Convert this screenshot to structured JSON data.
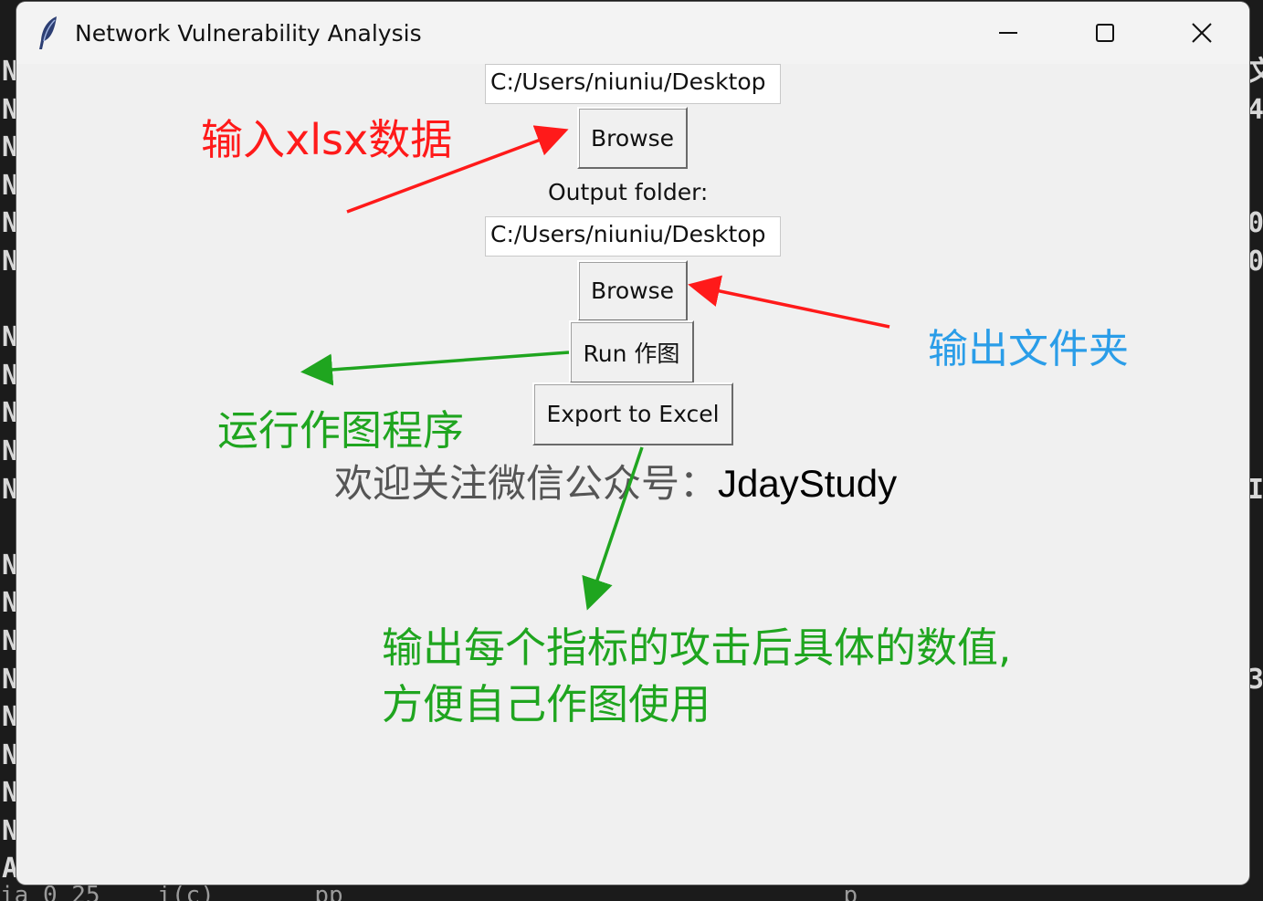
{
  "window": {
    "title": "Network Vulnerability Analysis"
  },
  "form": {
    "input_path": "C:/Users/niuniu/Desktop",
    "browse_input_label": "Browse",
    "output_label": "Output folder:",
    "output_path": "C:/Users/niuniu/Desktop",
    "browse_output_label": "Browse",
    "run_label": "Run 作图",
    "export_label": "Export to Excel"
  },
  "follow": {
    "prefix": "欢迎关注微信公众号：",
    "account": "JdayStudy"
  },
  "annotations": {
    "input_note": "输入xlsx数据",
    "output_note": "输出文件夹",
    "run_note": "运行作图程序",
    "export_note_line1": "输出每个指标的攻击后具体的数值,",
    "export_note_line2": "方便自己作图使用"
  },
  "background": {
    "left_glyphs": [
      "N",
      "N",
      "N",
      "N",
      "N",
      "N",
      "",
      "N",
      "N",
      "N",
      "N",
      "N",
      "",
      "N",
      "N",
      "N",
      "N",
      "N",
      "N",
      "N",
      "N",
      "A"
    ],
    "right_glyphs": [
      "文",
      "4",
      "",
      "",
      "0",
      "0",
      "",
      "",
      "",
      "",
      "",
      "I",
      "",
      "",
      "",
      "",
      "3",
      "",
      "",
      "",
      "",
      ""
    ],
    "bottom_text": "ia 0 25    i(c)       pp                                   p"
  },
  "colors": {
    "annotation_red": "#ff1a1a",
    "annotation_blue": "#2a9de8",
    "annotation_green": "#1fa51f",
    "window_bg": "#f0f0f0"
  },
  "icons": {
    "app": "feather-icon",
    "minimize": "minimize-icon",
    "maximize": "maximize-icon",
    "close": "close-icon"
  }
}
